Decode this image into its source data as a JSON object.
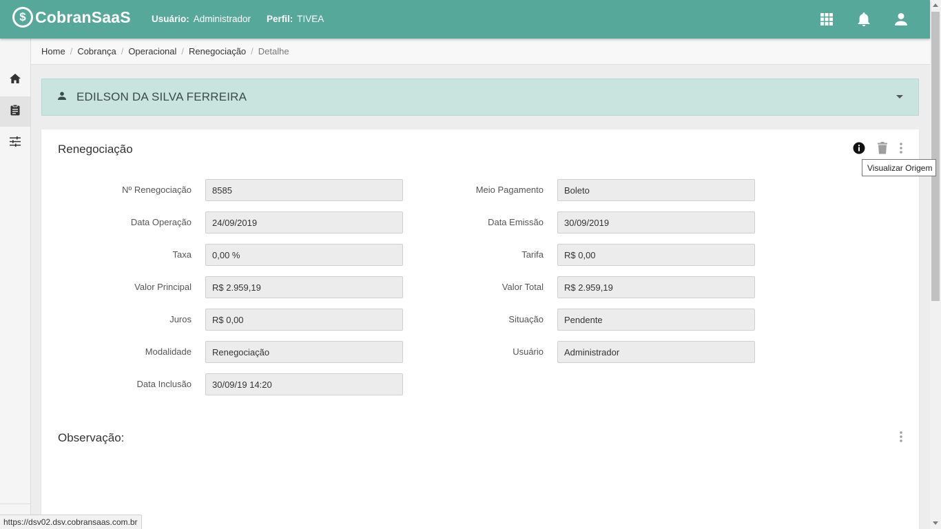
{
  "app": {
    "logo_mark": "$",
    "logo_text": "CobranSaaS"
  },
  "header": {
    "user_label": "Usuário:",
    "user_value": "Administrador",
    "profile_label": "Perfil:",
    "profile_value": "TIVEA",
    "icons": [
      "apps-grid-icon",
      "bell-icon",
      "user-account-icon"
    ]
  },
  "sidebar": {
    "items": [
      {
        "icon": "home-icon",
        "active": false
      },
      {
        "icon": "clipboard-icon",
        "active": true
      },
      {
        "icon": "sliders-icon",
        "active": false
      }
    ]
  },
  "breadcrumb": {
    "items": [
      "Home",
      "Cobrança",
      "Operacional",
      "Renegociação"
    ],
    "current": "Detalhe",
    "separator": "/"
  },
  "client": {
    "name": "EDILSON DA SILVA FERREIRA",
    "icon": "person-icon"
  },
  "card": {
    "title": "Renegociação",
    "tooltip": "Visualizar Origem",
    "left_fields": [
      {
        "label": "Nº Renegociação",
        "value": "8585"
      },
      {
        "label": "Data Operação",
        "value": "24/09/2019"
      },
      {
        "label": "Taxa",
        "value": "0,00 %"
      },
      {
        "label": "Valor Principal",
        "value": "R$ 2.959,19"
      },
      {
        "label": "Juros",
        "value": "R$ 0,00"
      },
      {
        "label": "Modalidade",
        "value": "Renegociação"
      },
      {
        "label": "Data Inclusão",
        "value": "30/09/19 14:20"
      }
    ],
    "right_fields": [
      {
        "label": "Meio Pagamento",
        "value": "Boleto"
      },
      {
        "label": "Data Emissão",
        "value": "30/09/2019"
      },
      {
        "label": "Tarifa",
        "value": "R$ 0,00"
      },
      {
        "label": "Valor Total",
        "value": "R$ 2.959,19"
      },
      {
        "label": "Situação",
        "value": "Pendente"
      },
      {
        "label": "Usuário",
        "value": "Administrador"
      }
    ],
    "observation_title": "Observação:"
  },
  "status_url": "https://dsv02.dsv.cobransaas.com.br",
  "colors": {
    "topbar": "#55a89a",
    "client_bar": "#c9e4de"
  }
}
